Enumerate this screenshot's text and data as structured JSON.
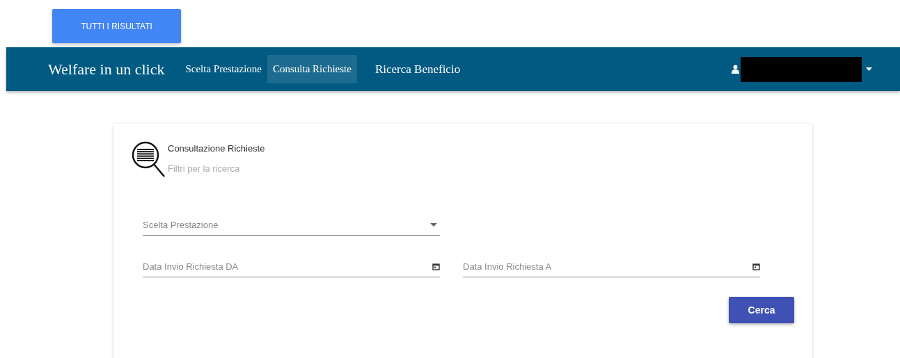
{
  "top_button": {
    "label": "TUTTI I RISULTATI"
  },
  "navbar": {
    "brand": "Welfare in un click",
    "items": [
      {
        "label": "Scelta Prestazione",
        "selected": false,
        "kind": "link"
      },
      {
        "label": "Consulta Richieste",
        "selected": true,
        "kind": "link"
      },
      {
        "label": "Ricerca Beneficio",
        "selected": false,
        "kind": "menu"
      }
    ]
  },
  "card": {
    "title": "Consultazione Richieste",
    "subtitle": "Filtri per la ricerca",
    "select": {
      "placeholder": "Scelta Prestazione"
    },
    "date_fields": [
      {
        "placeholder": "Data Invio Richiesta DA"
      },
      {
        "placeholder": "Data Invio Richiesta A"
      }
    ],
    "search_button": {
      "label": "Cerca"
    }
  }
}
